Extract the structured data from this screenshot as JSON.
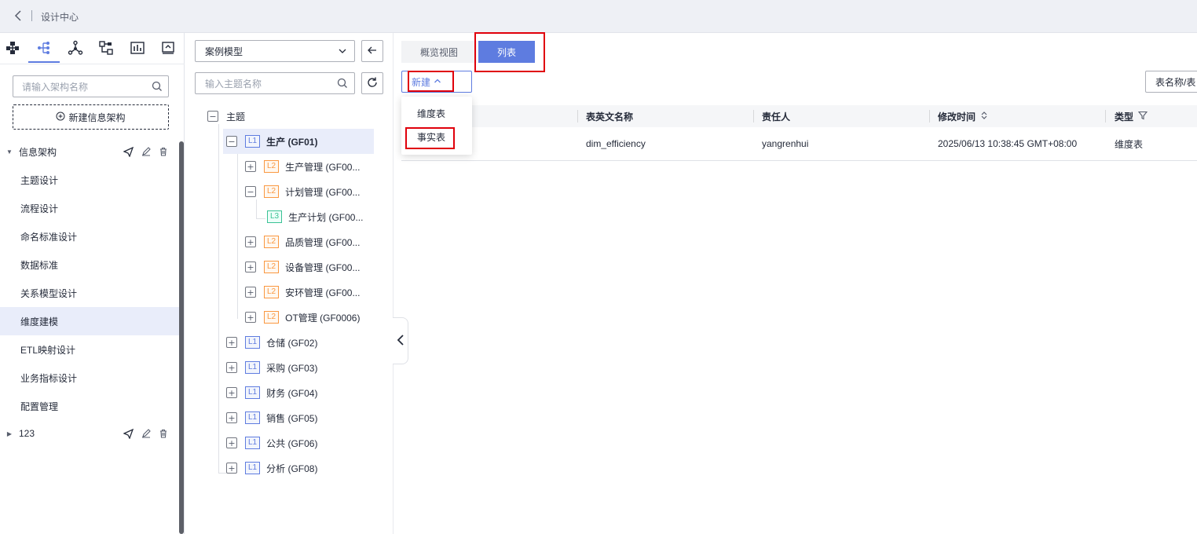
{
  "header": {
    "title": "设计中心"
  },
  "sidebar": {
    "icon_tabs": [
      "network-icon",
      "tree-icon",
      "graph-icon",
      "flow-icon",
      "metrics-icon",
      "config-icon"
    ],
    "search_placeholder": "请输入架构名称",
    "new_arch_label": "新建信息架构",
    "groups": [
      {
        "label": "信息架构",
        "expanded": true
      },
      {
        "label": "123",
        "expanded": false
      }
    ],
    "items": [
      {
        "label": "主题设计"
      },
      {
        "label": "流程设计"
      },
      {
        "label": "命名标准设计"
      },
      {
        "label": "数据标准"
      },
      {
        "label": "关系模型设计"
      },
      {
        "label": "维度建模",
        "active": true
      },
      {
        "label": "ETL映射设计"
      },
      {
        "label": "业务指标设计"
      },
      {
        "label": "配置管理"
      }
    ]
  },
  "topic_panel": {
    "model_select": "案例模型",
    "search_placeholder": "输入主题名称",
    "root": "主题",
    "nodes": [
      {
        "level": "L1",
        "label": "生产 (GF01)",
        "toggle": "−",
        "selected": true
      },
      {
        "level": "L2",
        "label": "生产管理 (GF00...",
        "toggle": "+"
      },
      {
        "level": "L2",
        "label": "计划管理 (GF00...",
        "toggle": "−"
      },
      {
        "level": "L3",
        "label": "生产计划 (GF00...",
        "toggle": ""
      },
      {
        "level": "L2",
        "label": "品质管理 (GF00...",
        "toggle": "+"
      },
      {
        "level": "L2",
        "label": "设备管理 (GF00...",
        "toggle": "+"
      },
      {
        "level": "L2",
        "label": "安环管理 (GF00...",
        "toggle": "+"
      },
      {
        "level": "L2",
        "label": "OT管理 (GF0006)",
        "toggle": "+"
      },
      {
        "level": "L1",
        "label": "仓储 (GF02)",
        "toggle": "+"
      },
      {
        "level": "L1",
        "label": "采购 (GF03)",
        "toggle": "+"
      },
      {
        "level": "L1",
        "label": "财务 (GF04)",
        "toggle": "+"
      },
      {
        "level": "L1",
        "label": "销售 (GF05)",
        "toggle": "+"
      },
      {
        "level": "L1",
        "label": "公共 (GF06)",
        "toggle": "+"
      },
      {
        "level": "L1",
        "label": "分析 (GF08)",
        "toggle": "+"
      }
    ]
  },
  "main": {
    "tabs": {
      "overview": "概览视图",
      "list": "列表"
    },
    "new_button": "新建",
    "new_menu": [
      "维度表",
      "事实表"
    ],
    "search_field": "表名称/表",
    "columns": [
      "表英文名称",
      "责任人",
      "修改时间",
      "类型"
    ],
    "rows": [
      {
        "name_en": "dim_efficiency",
        "owner": "yangrenhui",
        "modified": "2025/06/13 10:38:45 GMT+08:00",
        "type": "维度表"
      }
    ]
  },
  "colors": {
    "primary": "#5e7ce0",
    "highlight_box": "#e0000b",
    "active_bg": "#e9edfa"
  }
}
